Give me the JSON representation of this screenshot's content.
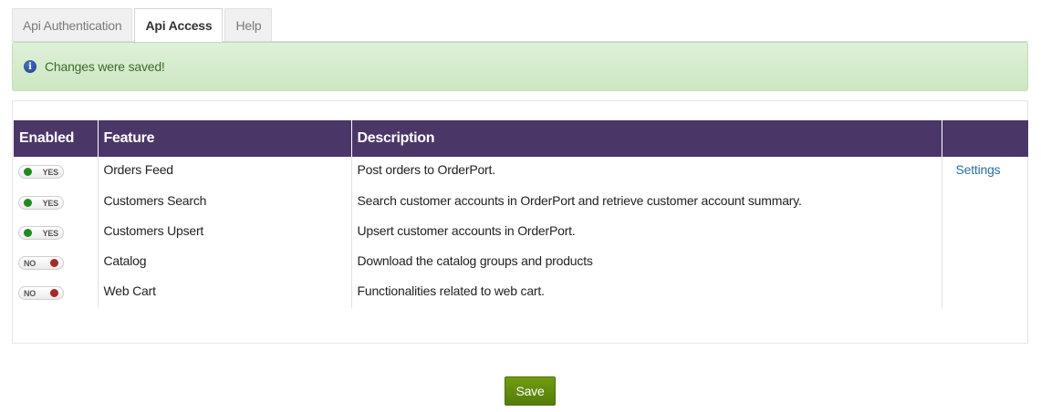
{
  "tabs": [
    {
      "label": "Api Authentication",
      "active": false
    },
    {
      "label": "Api Access",
      "active": true
    },
    {
      "label": "Help",
      "active": false
    }
  ],
  "alert": {
    "message": "Changes were saved!",
    "icon": "info-icon"
  },
  "table": {
    "headers": {
      "enabled": "Enabled",
      "feature": "Feature",
      "description": "Description",
      "action": ""
    },
    "rows": [
      {
        "enabled": true,
        "toggle_label": "YES",
        "feature": "Orders Feed",
        "description": "Post orders to OrderPort.",
        "action": "Settings"
      },
      {
        "enabled": true,
        "toggle_label": "YES",
        "feature": "Customers Search",
        "description": "Search customer accounts in OrderPort and retrieve customer account summary.",
        "action": ""
      },
      {
        "enabled": true,
        "toggle_label": "YES",
        "feature": "Customers Upsert",
        "description": "Upsert customer accounts in OrderPort.",
        "action": ""
      },
      {
        "enabled": false,
        "toggle_label": "NO",
        "feature": "Catalog",
        "description": "Download the catalog groups and products",
        "action": ""
      },
      {
        "enabled": false,
        "toggle_label": "NO",
        "feature": "Web Cart",
        "description": "Functionalities related to web cart.",
        "action": ""
      }
    ]
  },
  "save_label": "Save",
  "colors": {
    "header_bg": "#4a3767",
    "save_bg": "#5f8a0c",
    "toggle_on": "#1f8a1f",
    "toggle_off": "#a52a2a",
    "link": "#2a6fa8"
  }
}
